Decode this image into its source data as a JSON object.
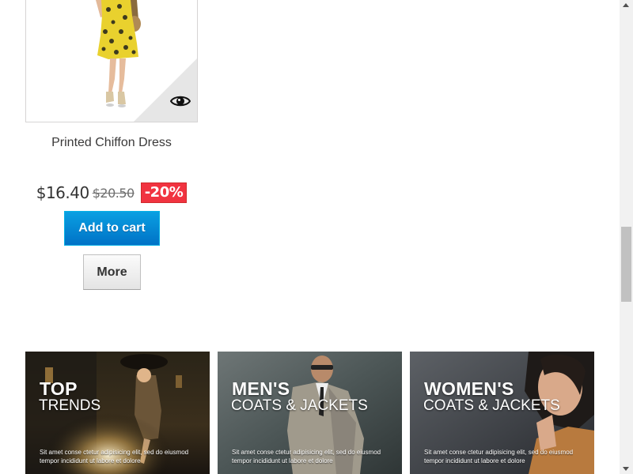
{
  "product": {
    "name": "Printed Chiffon Dress",
    "price": "$16.40",
    "old_price": "$20.50",
    "reduction": "-20%",
    "add_to_cart_label": "Add to cart",
    "more_label": "More",
    "quick_view_icon": "eye-icon"
  },
  "banners": [
    {
      "title": "TOP",
      "subtitle": "TRENDS",
      "description": "Sit amet conse ctetur adipisicing elit, sed do eiusmod tempor incididunt ut labore et dolore"
    },
    {
      "title": "MEN'S",
      "subtitle": "COATS & JACKETS",
      "description": "Sit amet conse ctetur adipisicing elit, sed do eiusmod tempor incididunt ut labore et dolore"
    },
    {
      "title": "WOMEN'S",
      "subtitle": "COATS & JACKETS",
      "description": "Sit amet conse ctetur adipisicing elit, sed do eiusmod tempor incididunt ut labore et dolore"
    }
  ],
  "colors": {
    "add_to_cart": "#0088d4",
    "reduction_badge": "#f13340",
    "product_name": "#3a3939"
  }
}
